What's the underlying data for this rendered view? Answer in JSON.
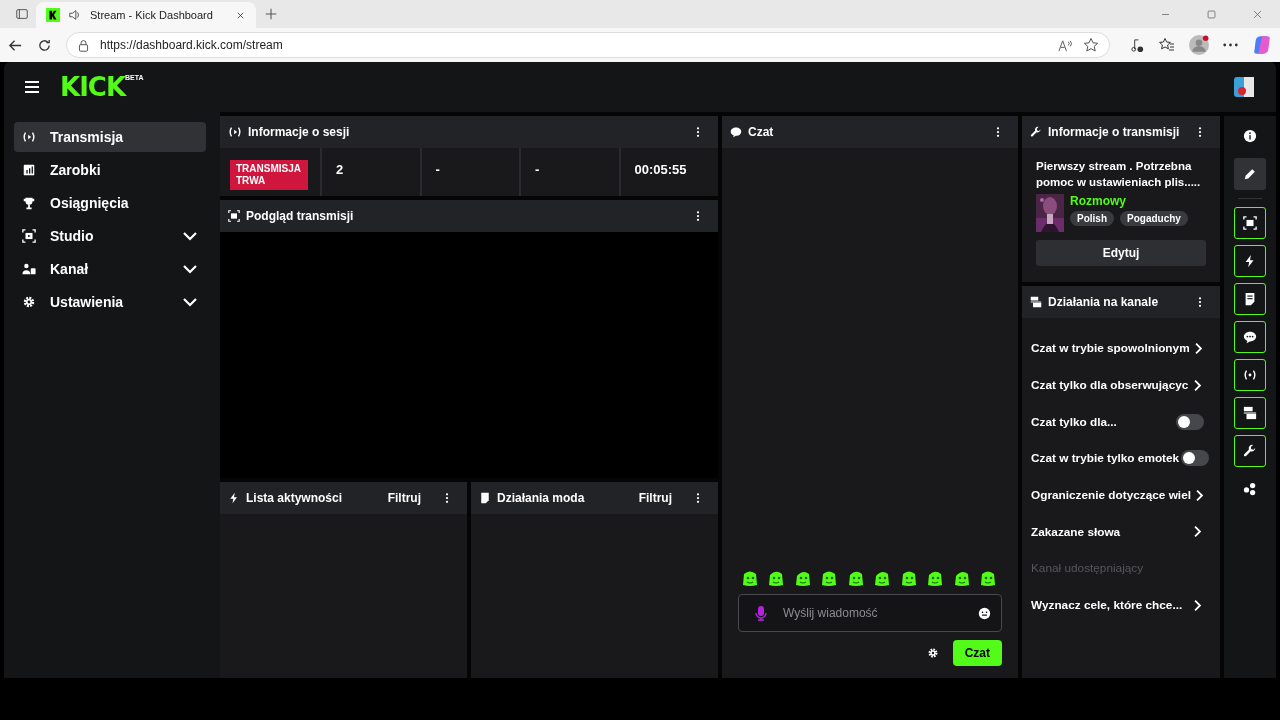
{
  "browser": {
    "tab_title": "Stream - Kick Dashboard",
    "url": "https://dashboard.kick.com/stream"
  },
  "logo": {
    "text": "KICK",
    "badge": "BETA"
  },
  "sidebar": {
    "items": [
      {
        "label": "Transmisja",
        "kind": "link",
        "selected": true
      },
      {
        "label": "Zarobki",
        "kind": "link",
        "selected": false
      },
      {
        "label": "Osiągnięcia",
        "kind": "link",
        "selected": false
      },
      {
        "label": "Studio",
        "kind": "group",
        "selected": false
      },
      {
        "label": "Kanał",
        "kind": "group",
        "selected": false
      },
      {
        "label": "Ustawienia",
        "kind": "group",
        "selected": false
      }
    ]
  },
  "session": {
    "title": "Informacje o sesji",
    "status": "TRANSMISJA TRWA",
    "stats": [
      "2",
      "-",
      "-",
      "00:05:55"
    ]
  },
  "preview": {
    "title": "Podgląd transmisji"
  },
  "activity": {
    "title": "Lista aktywności",
    "filter": "Filtruj"
  },
  "mod_actions": {
    "title": "Działania moda",
    "filter": "Filtruj"
  },
  "chat": {
    "title": "Czat",
    "placeholder": "Wyślij wiadomość",
    "send": "Czat"
  },
  "stream_info": {
    "title": "Informacje o transmisji",
    "stream_title": "Pierwszy stream . Potrzebna pomoc w ustawieniach plis.....",
    "category": "Rozmowy",
    "tags": [
      "Polish",
      "Pogaduchy"
    ],
    "edit": "Edytuj"
  },
  "channel_actions": {
    "title": "Działania na kanale",
    "items": [
      {
        "label": "Czat w trybie spowolnionym",
        "kind": "link"
      },
      {
        "label": "Czat tylko dla obserwującyc",
        "kind": "link"
      },
      {
        "label": "Czat tylko dla...",
        "kind": "toggle",
        "on": false
      },
      {
        "label": "Czat w trybie tylko emotek",
        "kind": "toggle",
        "on": false
      },
      {
        "label": "Ograniczenie dotyczące wiel",
        "kind": "link"
      },
      {
        "label": "Zakazane słowa",
        "kind": "link"
      },
      {
        "label": "Kanał udostępniający",
        "kind": "disabled"
      },
      {
        "label": "Wyznacz cele, które chce...",
        "kind": "link"
      }
    ]
  },
  "rail": [
    {
      "kind": "plain",
      "selected": false
    },
    {
      "kind": "plain",
      "selected": true
    },
    {
      "kind": "outlined",
      "selected": false
    },
    {
      "kind": "outlined",
      "selected": false
    },
    {
      "kind": "outlined",
      "selected": false
    },
    {
      "kind": "outlined",
      "selected": false
    },
    {
      "kind": "outlined",
      "selected": false
    },
    {
      "kind": "outlined",
      "selected": false
    },
    {
      "kind": "outlined",
      "selected": false
    },
    {
      "kind": "plain",
      "selected": false
    }
  ]
}
